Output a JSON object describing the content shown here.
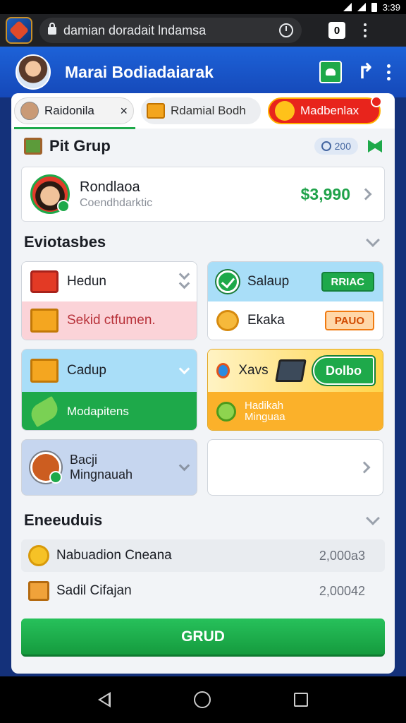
{
  "status_bar": {
    "time": "3:39"
  },
  "browser": {
    "url": "damian doradait lndamsa",
    "tab_count": "0"
  },
  "app": {
    "title": "Marai Bodiadaiarak"
  },
  "tabs": [
    {
      "label": "Raidonila",
      "close": "×"
    },
    {
      "label": "Rdamial Bodh"
    },
    {
      "label": "Madbenlax"
    }
  ],
  "group": {
    "title": "Pit Grup",
    "stat": "200"
  },
  "user": {
    "name": "Rondlaoa",
    "subtitle": "Coendhdarktic",
    "amount": "$3,990"
  },
  "section1": {
    "title": "Eviotasbes"
  },
  "cards": {
    "c1": {
      "top_label": "Hedun",
      "bottom_label": "Sekid ctfumen."
    },
    "c2": {
      "top_label": "Salaup",
      "top_pill": "RRIAC",
      "bottom_label": "Ekaka",
      "bottom_pill": "PAUO"
    },
    "c3": {
      "top_label": "Cadup",
      "bottom_label": "Modapitens"
    },
    "c4": {
      "top_label": "Xavs",
      "top_pill": "Dolbo",
      "bottom_label": "Hadikah Minguaa"
    },
    "c5": {
      "label": "Bacji Mingnauah"
    }
  },
  "section2": {
    "title": "Eneeuduis"
  },
  "transactions": [
    {
      "label": "Nabuadion Cneana",
      "amount": "2,000a3"
    },
    {
      "label": "Sadil Cifajan",
      "amount": "2,00042"
    }
  ],
  "primary_button": "GRUD",
  "colors": {
    "accent": "#1ea94a",
    "header": "#1d62d8",
    "danger": "#e8241c",
    "warning": "#f4a620"
  }
}
